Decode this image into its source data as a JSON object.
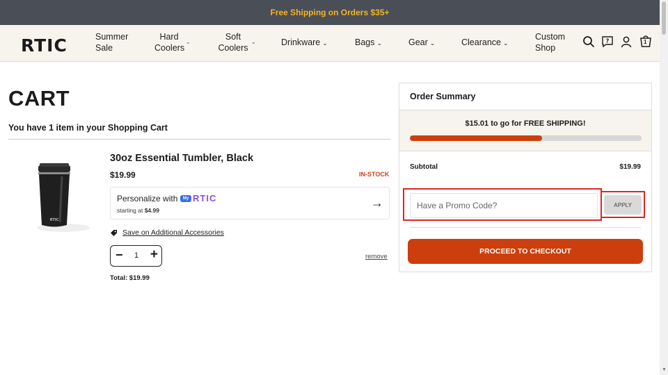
{
  "banner": {
    "text": "Free Shipping on Orders $35+"
  },
  "nav": {
    "logo": "RTIC",
    "items": [
      {
        "label_line1": "Summer",
        "label_line2": "Sale"
      },
      {
        "label_line1": "Hard",
        "label_line2": "Coolers"
      },
      {
        "label_line1": "Soft",
        "label_line2": "Coolers"
      },
      {
        "label": "Drinkware"
      },
      {
        "label": "Bags"
      },
      {
        "label": "Gear"
      },
      {
        "label": "Clearance"
      },
      {
        "label_line1": "Custom",
        "label_line2": "Shop"
      }
    ],
    "cart_count": "1",
    "icons": [
      "search-icon",
      "chat-help-icon",
      "account-icon",
      "cart-icon"
    ]
  },
  "cart": {
    "title": "CART",
    "items_count_text": "You have 1 item in your Shopping Cart",
    "item": {
      "name": "30oz Essential Tumbler, Black",
      "price": "$19.99",
      "stock": "IN-STOCK",
      "personalize_text": "Personalize with",
      "personalize_brand_prefix": "My",
      "personalize_brand": "RTIC",
      "starting_at_label": "starting at",
      "starting_at_price": "$4.99",
      "accessories_link": "Save on Additional Accessories",
      "quantity": "1",
      "remove_label": "remove",
      "total_label": "Total:",
      "total_value": "$19.99"
    }
  },
  "summary": {
    "title": "Order Summary",
    "shipping_message": "$15.01 to go for FREE SHIPPING!",
    "shipping_progress": 0.57,
    "subtotal_label": "Subtotal",
    "subtotal_value": "$19.99",
    "promo_placeholder": "Have a Promo Code?",
    "apply_label": "APPLY",
    "checkout_label": "PROCEED TO CHECKOUT"
  },
  "colors": {
    "brand_accent": "#cc3f0c",
    "banner_bg": "#4a4f57",
    "banner_text": "#f5b324",
    "highlight": "#e02424"
  }
}
